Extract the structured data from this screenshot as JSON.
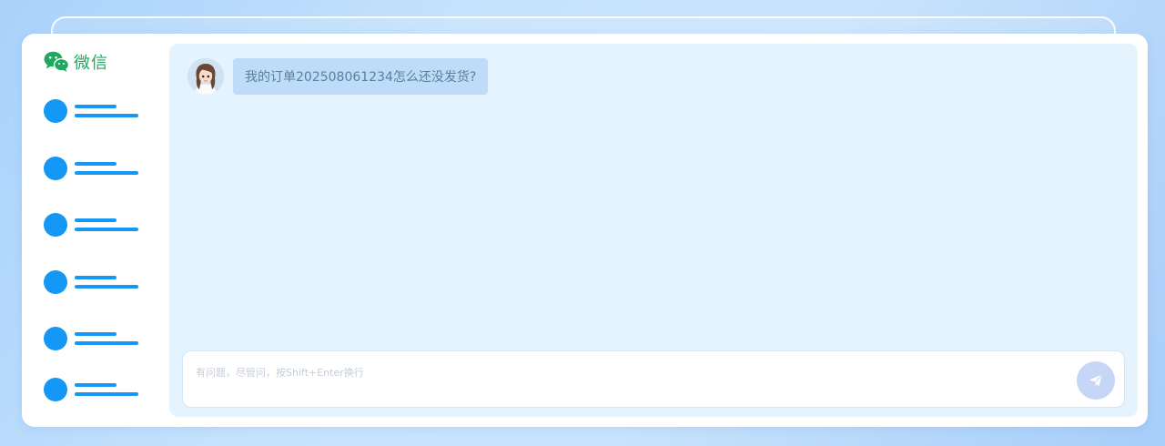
{
  "brand": {
    "name": "微信",
    "icon": "wechat-logo-icon",
    "color": "#20a861"
  },
  "sidebar": {
    "items": [
      {
        "name": "nav-placeholder-1"
      },
      {
        "name": "nav-placeholder-2"
      },
      {
        "name": "nav-placeholder-3"
      },
      {
        "name": "nav-placeholder-4"
      },
      {
        "name": "nav-placeholder-5"
      },
      {
        "name": "nav-placeholder-6"
      }
    ],
    "accent_color": "#1597f5"
  },
  "chat": {
    "messages": [
      {
        "sender_icon": "user-avatar",
        "text": "我的订单202508061234怎么还没发货?"
      }
    ]
  },
  "composer": {
    "placeholder": "有问题，尽管问，按Shift+Enter换行",
    "value": "",
    "send_icon": "paper-plane-icon"
  },
  "colors": {
    "panel_background": "#e5f3fe",
    "bubble_background": "#bddcf8",
    "send_button": "#c5d6f7"
  }
}
